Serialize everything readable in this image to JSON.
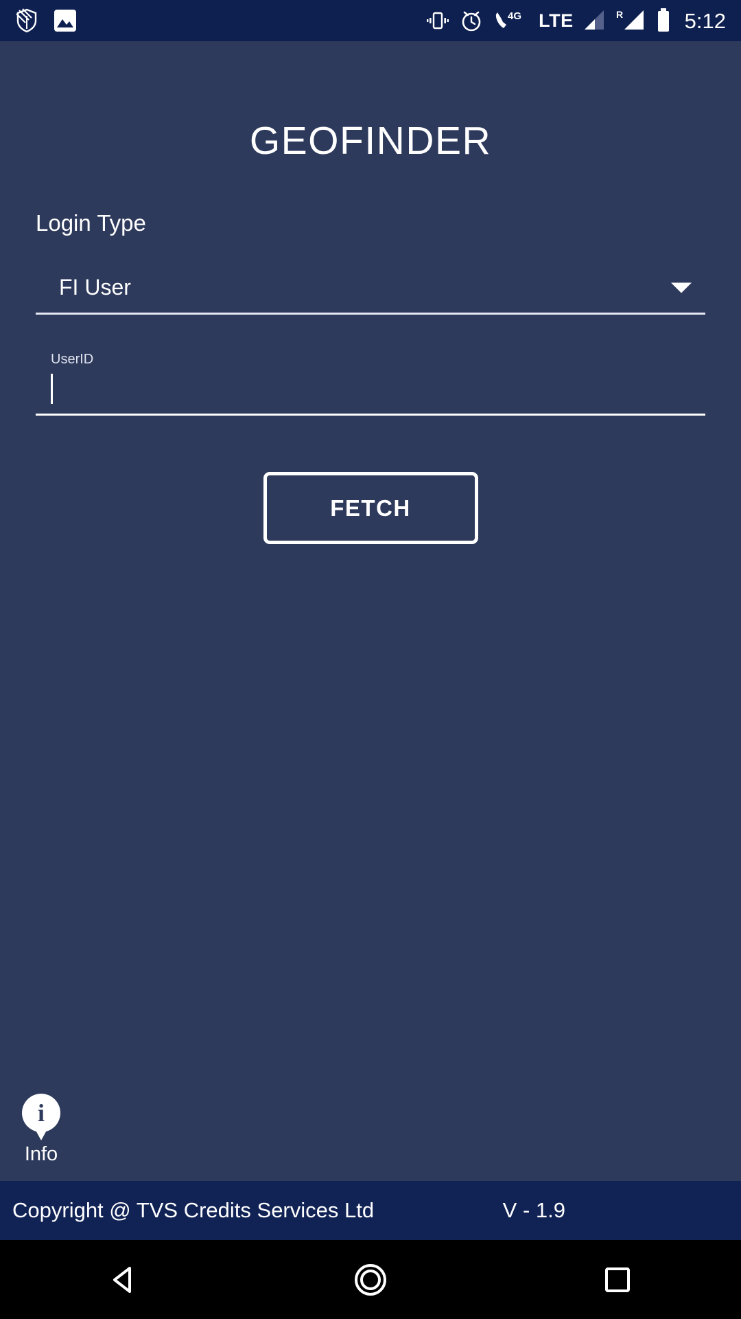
{
  "status_bar": {
    "left_icons": [
      {
        "name": "shield-arrows-icon",
        "label": "security-vpn"
      },
      {
        "name": "image-icon",
        "label": "screenshot"
      }
    ],
    "right_icons": [
      {
        "name": "vibrate-icon",
        "label": "vibrate"
      },
      {
        "name": "alarm-clock-icon",
        "label": "alarm"
      },
      {
        "name": "phone-4g-icon",
        "label": "4G"
      },
      {
        "name": "lte-label",
        "label": "LTE"
      },
      {
        "name": "signal-bars-sim1-icon",
        "label": "signal-1"
      },
      {
        "name": "signal-bars-sim2-roaming-icon",
        "label": "R"
      },
      {
        "name": "battery-icon",
        "label": "battery"
      }
    ],
    "network_4g": "4G",
    "network_lte": "LTE",
    "roaming": "R",
    "clock": "5:12"
  },
  "app": {
    "title": "GEOFINDER"
  },
  "form": {
    "login_type_label": "Login Type",
    "login_type_value": "FI User",
    "login_type_options": [
      "FI User"
    ],
    "userid_label": "UserID",
    "userid_value": "",
    "userid_placeholder": "",
    "fetch_label": "FETCH"
  },
  "info": {
    "label": "Info",
    "icon": "info-pin-icon"
  },
  "footer": {
    "copyright": "Copyright @ TVS Credits Services Ltd",
    "version": "V - 1.9"
  },
  "navbar": {
    "back": "back-triangle-icon",
    "home": "home-circle-icon",
    "recents": "recents-square-icon"
  },
  "colors": {
    "background": "#2e3a5c",
    "status_bar": "#0e2050",
    "footer": "#112355",
    "accent": "#ffffff",
    "navbar": "#000000"
  }
}
